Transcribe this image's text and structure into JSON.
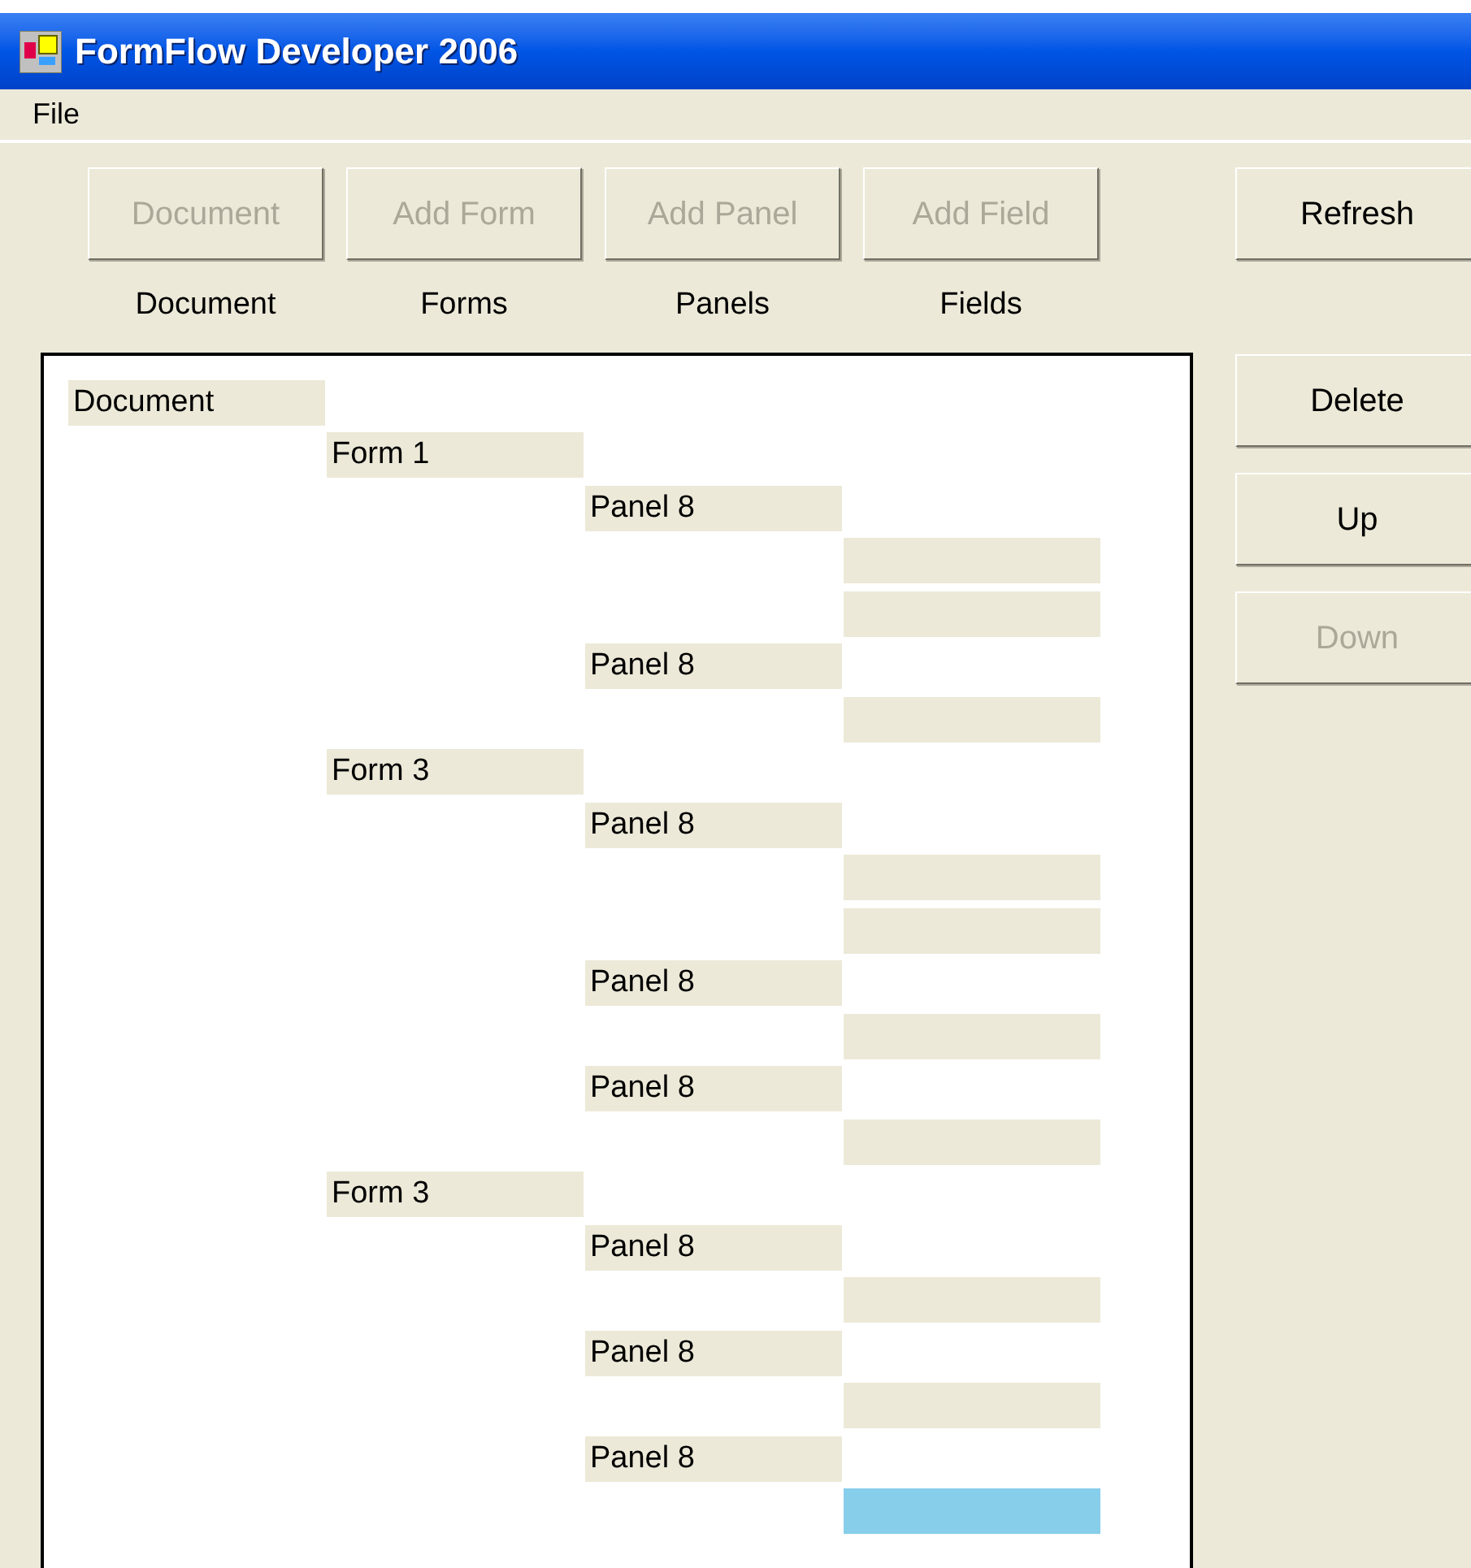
{
  "window": {
    "title": "FormFlow Developer 2006"
  },
  "menu": [
    "File"
  ],
  "toolbar": [
    {
      "label": "Document",
      "caption": "Document",
      "disabled": true
    },
    {
      "label": "Add Form",
      "caption": "Forms",
      "disabled": true
    },
    {
      "label": "Add Panel",
      "caption": "Panels",
      "disabled": true
    },
    {
      "label": "Add Field",
      "caption": "Fields",
      "disabled": true
    }
  ],
  "side_buttons": [
    {
      "label": "Refresh",
      "disabled": false
    },
    {
      "label": "Delete",
      "disabled": false
    },
    {
      "label": "Up",
      "disabled": false
    },
    {
      "label": "Down",
      "disabled": true
    }
  ],
  "tree": [
    {
      "label": "Document",
      "selected": false,
      "children": [
        {
          "label": "Form 1",
          "selected": false,
          "children": [
            {
              "label": "Panel 8",
              "selected": false,
              "children": [
                {
                  "selected": false
                },
                {
                  "selected": false
                }
              ]
            },
            {
              "label": "Panel 8",
              "selected": false,
              "children": [
                {
                  "selected": false
                }
              ]
            }
          ]
        },
        {
          "label": "Form 3",
          "selected": false,
          "children": [
            {
              "label": "Panel 8",
              "selected": false,
              "children": [
                {
                  "selected": false
                },
                {
                  "selected": false
                }
              ]
            },
            {
              "label": "Panel 8",
              "selected": false,
              "children": [
                {
                  "selected": false
                }
              ]
            },
            {
              "label": "Panel 8",
              "selected": false,
              "children": [
                {
                  "selected": false
                }
              ]
            }
          ]
        },
        {
          "label": "Form 3",
          "selected": false,
          "children": [
            {
              "label": "Panel 8",
              "selected": false,
              "children": [
                {
                  "selected": false
                }
              ]
            },
            {
              "label": "Panel 8",
              "selected": false,
              "children": [
                {
                  "selected": false
                }
              ]
            },
            {
              "label": "Panel 8",
              "selected": false,
              "children": [
                {
                  "selected": true
                }
              ]
            }
          ]
        }
      ]
    }
  ]
}
